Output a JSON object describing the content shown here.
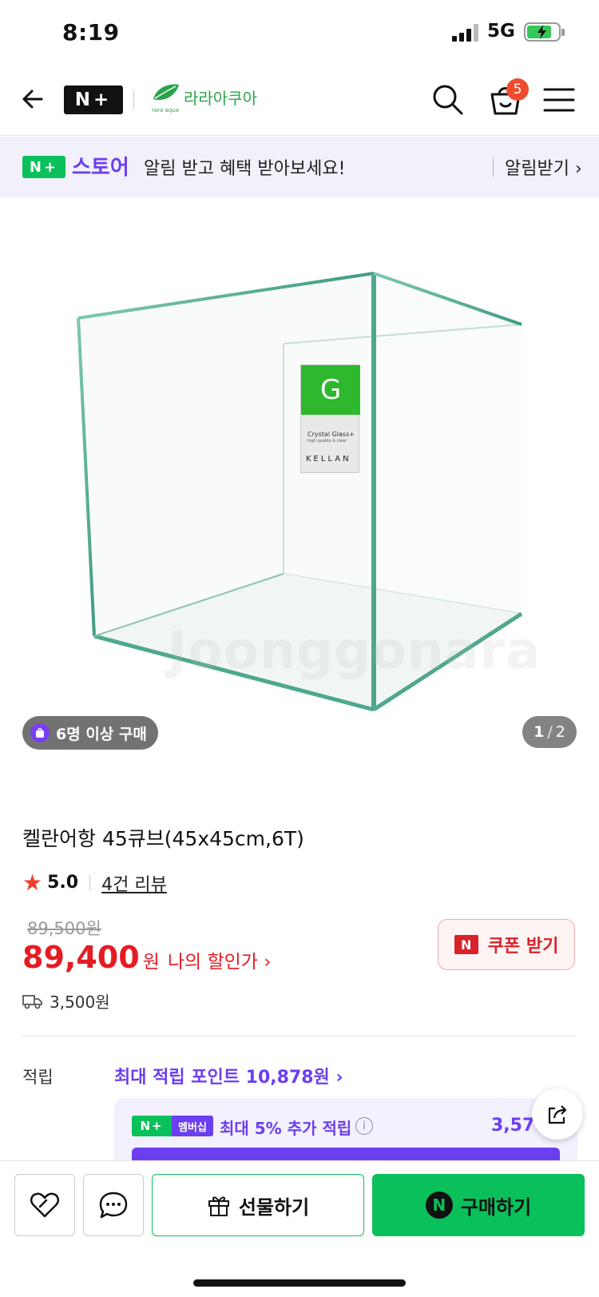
{
  "status": {
    "time": "8:19",
    "network": "5G"
  },
  "header": {
    "brand_badge": "N+",
    "store_name": "라라아쿠아",
    "store_sub": "rara aqua",
    "cart_count": "5"
  },
  "promo": {
    "badge": "N+",
    "store_label": "스토어",
    "message": "알림 받고 혜택 받아보세요!",
    "alarm_label": "알림받기 ›"
  },
  "gallery": {
    "tag_letter": "G",
    "tag_line1": "Crystal Glass+",
    "tag_line2": "high quality & clear",
    "tag_brand": "KELLAN",
    "watermark": "Joonggonara",
    "buyers": "6명 이상 구매",
    "page_current": "1",
    "page_total": "2"
  },
  "product": {
    "title": "켈란어항 45큐브(45x45cm,6T)",
    "rating": "5.0",
    "reviews": "4건 리뷰",
    "original_price": "89,500원",
    "price": "89,400",
    "currency": "원",
    "my_discount": "나의 할인가 ›",
    "coupon_label": "쿠폰 받기",
    "shipping": "3,500원"
  },
  "points": {
    "label": "적립",
    "max": "최대 적립 포인트 10,878원 ›",
    "member_badge_a": "N+",
    "member_badge_b": "멤버십",
    "member_text": "최대 5% 추가 적립",
    "member_value": "3,570"
  },
  "bottom": {
    "gift_label": "선물하기",
    "buy_label": "구매하기"
  },
  "colors": {
    "naver_green": "#09c05b",
    "accent_purple": "#6b3ff0",
    "price_red": "#e51c23"
  }
}
